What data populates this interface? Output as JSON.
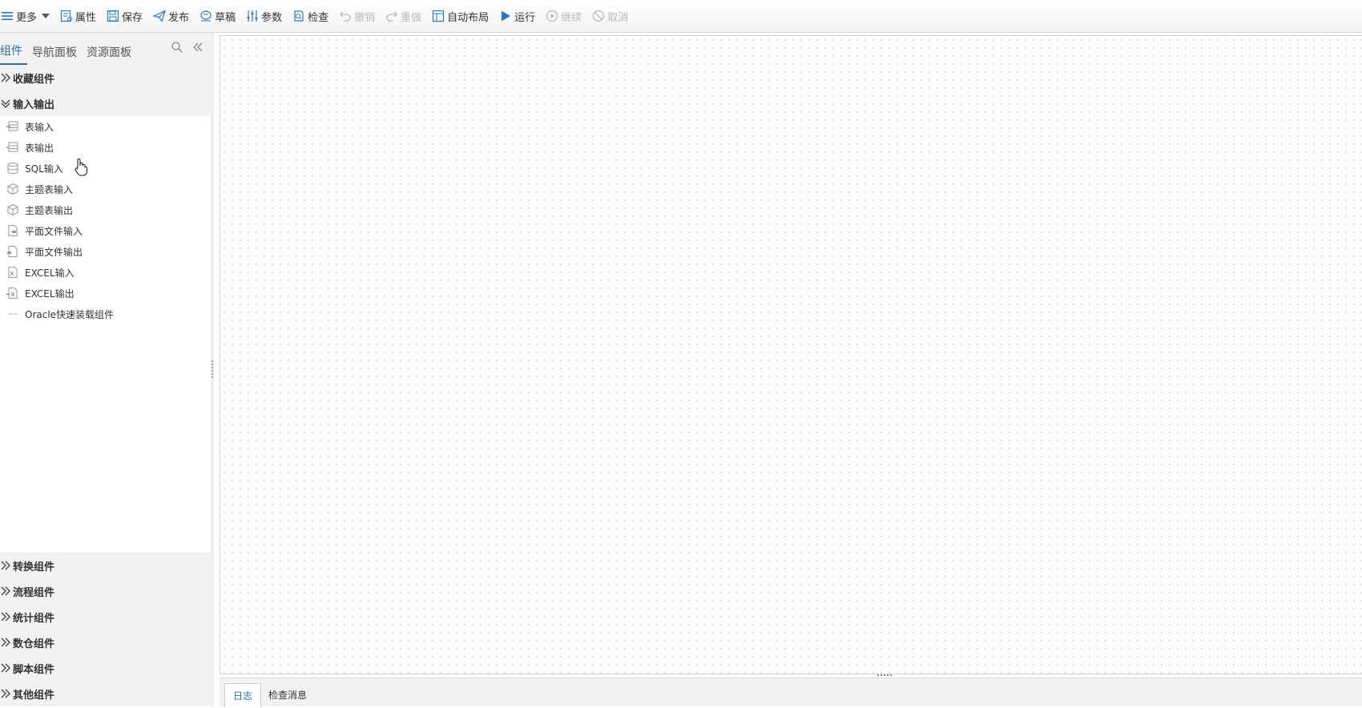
{
  "toolbar": {
    "more": "更多",
    "properties": "属性",
    "save": "保存",
    "publish": "发布",
    "draft": "草稿",
    "params": "参数",
    "check": "检查",
    "undo": "撤销",
    "redo": "重做",
    "auto_layout": "自动布局",
    "run": "运行",
    "continue": "继续",
    "cancel": "取消"
  },
  "left_panel": {
    "tabs": [
      "组件",
      "导航面板",
      "资源面板"
    ],
    "sections_top": [
      "收藏组件",
      "输入输出"
    ],
    "io_items": [
      "表输入",
      "表输出",
      "SQL输入",
      "主题表输入",
      "主题表输出",
      "平面文件输入",
      "平面文件输出",
      "EXCEL输入",
      "EXCEL输出",
      "Oracle快速装载组件"
    ],
    "sections_bottom": [
      "转换组件",
      "流程组件",
      "统计组件",
      "数仓组件",
      "脚本组件",
      "其他组件"
    ]
  },
  "bottom_panel": {
    "tabs": [
      "日志",
      "检查消息"
    ]
  },
  "colors": {
    "accent": "#2f6f9f",
    "run_icon": "#2a78c8",
    "disabled": "#b9b9b9"
  }
}
